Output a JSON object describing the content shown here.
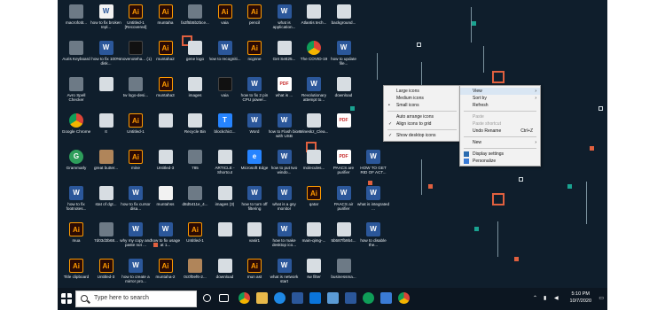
{
  "colors": {
    "desktop_bg": "#0f1e2c",
    "accent_orange": "#e0603f",
    "accent_teal": "#1aa391",
    "taskbar": "#0c1621"
  },
  "desktop_icons": [
    {
      "label": "macrofotit...",
      "kind": "img",
      "glyph": ""
    },
    {
      "label": "how to fix broken repl...",
      "kind": "doc",
      "glyph": "W"
    },
    {
      "label": "Untitled-1 [Recovered]",
      "kind": "ai",
      "glyph": "Ai"
    },
    {
      "label": "muntaha",
      "kind": "ai",
      "glyph": "Ai"
    },
    {
      "label": "fa3f5b5b2bce...",
      "kind": "img",
      "glyph": ""
    },
    {
      "label": "vaia",
      "kind": "ai",
      "glyph": "Ai"
    },
    {
      "label": "pencil",
      "kind": "ai",
      "glyph": "Ai"
    },
    {
      "label": "what is application...",
      "kind": "word",
      "glyph": "W"
    },
    {
      "label": "Atlantis tech...",
      "kind": "gen",
      "glyph": ""
    },
    {
      "label": "background...",
      "kind": "gen",
      "glyph": ""
    },
    {
      "label": "Auris Keyboard",
      "kind": "img",
      "glyph": ""
    },
    {
      "label": "how to fix 100% disk...",
      "kind": "word",
      "glyph": "W"
    },
    {
      "label": "movenoteha... (1)",
      "kind": "dark",
      "glyph": ""
    },
    {
      "label": "muntaha2",
      "kind": "ai",
      "glyph": "Ai"
    },
    {
      "label": "gene logo",
      "kind": "gen",
      "glyph": ""
    },
    {
      "label": "how to recogniti...",
      "kind": "word",
      "glyph": "W"
    },
    {
      "label": "ncgnne",
      "kind": "ai",
      "glyph": "Ai"
    },
    {
      "label": "Get Sett25...",
      "kind": "gen",
      "glyph": ""
    },
    {
      "label": "The COVID-19",
      "kind": "chrome",
      "glyph": ""
    },
    {
      "label": "how to update file...",
      "kind": "word",
      "glyph": "W"
    },
    {
      "label": "Avro Spell Checker",
      "kind": "img",
      "glyph": ""
    },
    {
      "label": "",
      "kind": "gen",
      "glyph": ""
    },
    {
      "label": "tw logo-desi...",
      "kind": "img",
      "glyph": ""
    },
    {
      "label": "muntaha3",
      "kind": "ai",
      "glyph": "Ai"
    },
    {
      "label": "images",
      "kind": "gen",
      "glyph": ""
    },
    {
      "label": "vaia",
      "kind": "dark",
      "glyph": ""
    },
    {
      "label": "how to fix 2 pin CPU power...",
      "kind": "word",
      "glyph": "W"
    },
    {
      "label": "what is ...",
      "kind": "pdf",
      "glyph": "PDF"
    },
    {
      "label": "Revolutionary attempt to...",
      "kind": "word",
      "glyph": "W"
    },
    {
      "label": "download",
      "kind": "gen",
      "glyph": ""
    },
    {
      "label": "Google Chrome",
      "kind": "chrome",
      "glyph": ""
    },
    {
      "label": "It",
      "kind": "gen",
      "glyph": ""
    },
    {
      "label": "Untitled-1",
      "kind": "ai",
      "glyph": "Ai"
    },
    {
      "label": "",
      "kind": "gen",
      "glyph": ""
    },
    {
      "label": "Recycle Bin",
      "kind": "gen",
      "glyph": ""
    },
    {
      "label": "blockchict...",
      "kind": "blue",
      "glyph": "T"
    },
    {
      "label": "Word",
      "kind": "word",
      "glyph": "W"
    },
    {
      "label": "how to Flash bios with USB",
      "kind": "word",
      "glyph": "W"
    },
    {
      "label": "Mineskz_Clea...",
      "kind": "gen",
      "glyph": ""
    },
    {
      "label": "",
      "kind": "pdf",
      "glyph": "PDF"
    },
    {
      "label": "Grammarly",
      "kind": "green",
      "glyph": "G"
    },
    {
      "label": "great butter...",
      "kind": "img2",
      "glyph": ""
    },
    {
      "label": "mine",
      "kind": "ai",
      "glyph": "Ai"
    },
    {
      "label": "Untitled-3",
      "kind": "gen",
      "glyph": ""
    },
    {
      "label": "785",
      "kind": "img",
      "glyph": ""
    },
    {
      "label": "ARTICLE - Shortcut",
      "kind": "gen",
      "glyph": ""
    },
    {
      "label": "Microsoft Edge",
      "kind": "blue",
      "glyph": "e"
    },
    {
      "label": "how to put two windo...",
      "kind": "word",
      "glyph": "W"
    },
    {
      "label": "molecules...",
      "kind": "gen",
      "glyph": ""
    },
    {
      "label": "PAACS are purifier",
      "kind": "pdf",
      "glyph": "PDF"
    },
    {
      "label": "HOW TO GET RID OF ACT...",
      "kind": "word",
      "glyph": "W"
    },
    {
      "label": "how to fix footnotes...",
      "kind": "word",
      "glyph": "W"
    },
    {
      "label": "stat of dgt...",
      "kind": "gen",
      "glyph": ""
    },
    {
      "label": "how to fix cursor disa...",
      "kind": "word",
      "glyph": "W"
    },
    {
      "label": "muntahss",
      "kind": "doc",
      "glyph": ""
    },
    {
      "label": "d8d5411e_4...",
      "kind": "img",
      "glyph": ""
    },
    {
      "label": "images (3)",
      "kind": "gen",
      "glyph": ""
    },
    {
      "label": "how to turn off filtering",
      "kind": "word",
      "glyph": "W"
    },
    {
      "label": "what is a gsy monitor",
      "kind": "word",
      "glyph": "W"
    },
    {
      "label": "qatar",
      "kind": "ai",
      "glyph": "Ai"
    },
    {
      "label": "PAACS air purifier",
      "kind": "word",
      "glyph": "W"
    },
    {
      "label": "what is integrated ...",
      "kind": "word",
      "glyph": "W"
    },
    {
      "label": "mua",
      "kind": "ai",
      "glyph": "Ai"
    },
    {
      "label": "7d03d3b68...",
      "kind": "img",
      "glyph": ""
    },
    {
      "label": "why my copy and paste not ...",
      "kind": "word",
      "glyph": "W"
    },
    {
      "label": "how to fix usage at 1...",
      "kind": "word",
      "glyph": "W"
    },
    {
      "label": "Untitled-1",
      "kind": "ai",
      "glyph": "Ai"
    },
    {
      "label": "",
      "kind": "gen",
      "glyph": ""
    },
    {
      "label": "vasir1",
      "kind": "gen",
      "glyph": ""
    },
    {
      "label": "how to make desktop ico...",
      "kind": "word",
      "glyph": "W"
    },
    {
      "label": "main-qimg-...",
      "kind": "gen",
      "glyph": ""
    },
    {
      "label": "5b587fb9b4...",
      "kind": "gen",
      "glyph": ""
    },
    {
      "label": "how to disable the...",
      "kind": "word",
      "glyph": "W"
    },
    {
      "label": "Title clipboard",
      "kind": "ai",
      "glyph": "Ai"
    },
    {
      "label": "Untitled-3",
      "kind": "ai",
      "glyph": "Ai"
    },
    {
      "label": "how to create a mirror pro...",
      "kind": "word",
      "glyph": "W"
    },
    {
      "label": "muntaha-2",
      "kind": "ai",
      "glyph": "Ai"
    },
    {
      "label": "0c0f0ef6-2...",
      "kind": "img2",
      "glyph": ""
    },
    {
      "label": "download",
      "kind": "gen",
      "glyph": ""
    },
    {
      "label": "mun ast",
      "kind": "ai",
      "glyph": "Ai"
    },
    {
      "label": "what is network start",
      "kind": "word",
      "glyph": "W"
    },
    {
      "label": "sw filter",
      "kind": "gen",
      "glyph": ""
    },
    {
      "label": "businessma...",
      "kind": "img",
      "glyph": ""
    }
  ],
  "context_menu": {
    "items": [
      {
        "label": "View",
        "arrow": "›"
      },
      {
        "label": "Sort by",
        "arrow": "›"
      },
      {
        "label": "Refresh"
      },
      {
        "label": "Paste",
        "disabled": true
      },
      {
        "label": "Paste shortcut",
        "disabled": true
      },
      {
        "label": "Undo Rename",
        "shortcut": "Ctrl+Z"
      },
      {
        "label": "New",
        "arrow": "›"
      },
      {
        "label": "Display settings"
      },
      {
        "label": "Personalize"
      }
    ]
  },
  "view_submenu": {
    "items": [
      {
        "label": "Large icons"
      },
      {
        "label": "Medium icons"
      },
      {
        "label": "Small icons",
        "mark": "•"
      },
      {
        "label": "Auto arrange icons"
      },
      {
        "label": "Align icons to grid",
        "mark": "✓"
      },
      {
        "label": "Show desktop icons",
        "mark": "✓"
      }
    ]
  },
  "taskbar": {
    "search_placeholder": "Type here to search",
    "start_icon": "windows-logo",
    "clock_time": "5:10 PM",
    "clock_date": "10/7/2020"
  }
}
